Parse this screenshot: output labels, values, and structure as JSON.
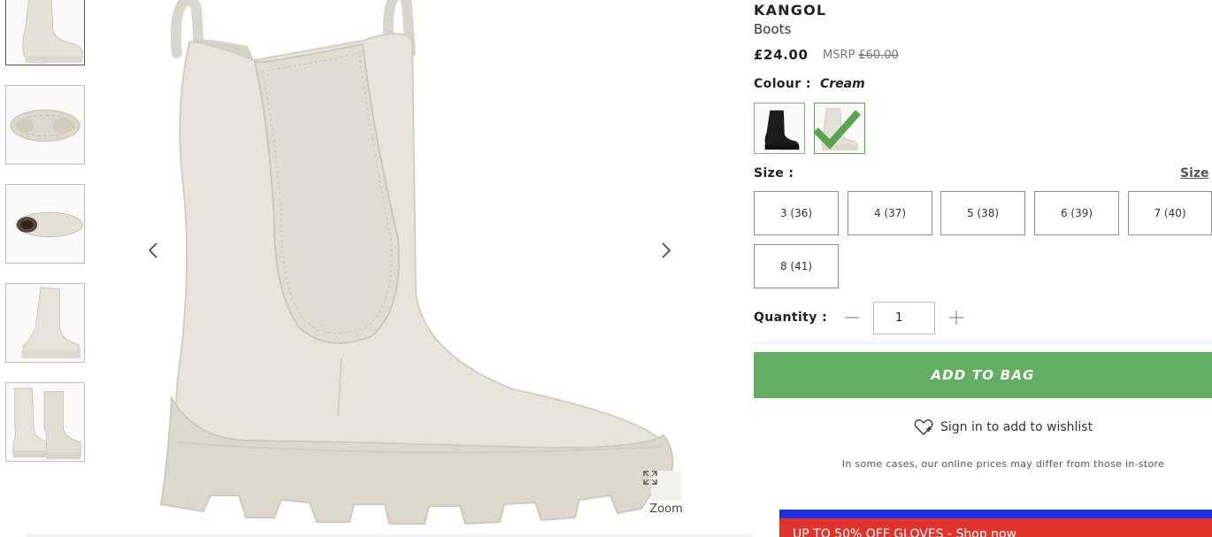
{
  "thumbnails": [
    {
      "icon": "boot-side-thumbnail",
      "active": true
    },
    {
      "icon": "boot-sole-thumbnail",
      "active": false
    },
    {
      "icon": "boot-top-thumbnail",
      "active": false
    },
    {
      "icon": "boot-back-thumbnail",
      "active": false
    },
    {
      "icon": "boot-pair-thumbnail",
      "active": false
    }
  ],
  "gallery": {
    "prev_icon": "chevron-left-icon",
    "next_icon": "chevron-right-icon",
    "zoom_label": "Zoom",
    "zoom_icon": "expand-icon"
  },
  "product": {
    "brand": "KANGOL",
    "name": "Boots",
    "price": "£24.00",
    "msrp_label": "MSRP",
    "msrp_value": "£60.00"
  },
  "colour": {
    "label": "Colour :",
    "value": "Cream",
    "swatches": [
      {
        "name": "Black",
        "color": "#1c1c1c",
        "selected": false
      },
      {
        "name": "Cream",
        "color": "#e4e1d8",
        "selected": true
      }
    ],
    "selected_check_color": "#5aa34f"
  },
  "size": {
    "label": "Size :",
    "guide_link": "Size",
    "options": [
      "3 (36)",
      "4 (37)",
      "5 (38)",
      "6 (39)",
      "7 (40)",
      "8 (41)"
    ]
  },
  "quantity": {
    "label": "Quantity :",
    "value": "1"
  },
  "actions": {
    "add_to_bag": "ADD TO BAG",
    "add_to_bag_color": "#64ae62",
    "wishlist": "Sign in to add to wishlist",
    "wishlist_icon": "heart-plus-icon"
  },
  "disclaimer": "In some cases, our online prices may differ from those in-store",
  "promo": {
    "text": "UP TO 50% OFF GLOVES - Shop now",
    "stripe_color": "#1e2fe0",
    "banner_color": "#e1322b"
  }
}
